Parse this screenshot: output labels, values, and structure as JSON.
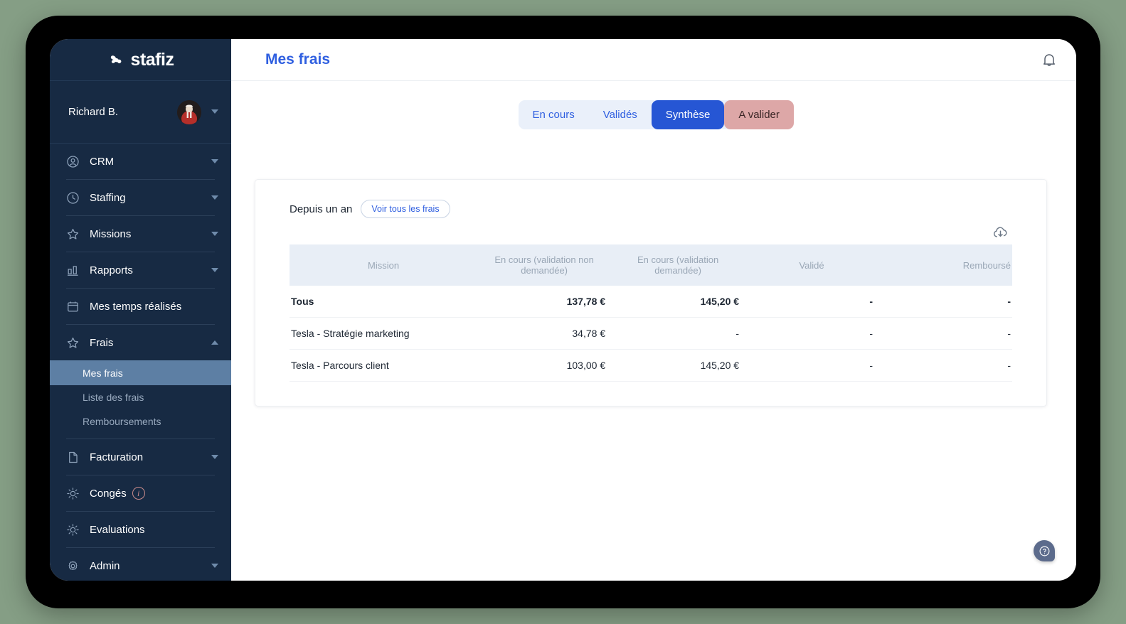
{
  "brand": {
    "name": "stafiz",
    "logo_icon": "stafiz-pinwheel-logo"
  },
  "user": {
    "name": "Richard B.",
    "avatar_icon": "user-avatar"
  },
  "sidebar": {
    "items": [
      {
        "label": "CRM",
        "icon": "user-circle-icon",
        "expandable": true
      },
      {
        "label": "Staffing",
        "icon": "clock-icon",
        "expandable": true
      },
      {
        "label": "Missions",
        "icon": "star-icon",
        "expandable": true
      },
      {
        "label": "Rapports",
        "icon": "bar-chart-icon",
        "expandable": true
      },
      {
        "label": "Mes temps réalisés",
        "icon": "calendar-icon",
        "expandable": false
      },
      {
        "label": "Frais",
        "icon": "star-icon",
        "expandable": true,
        "expanded": true
      },
      {
        "label": "Facturation",
        "icon": "document-icon",
        "expandable": true
      },
      {
        "label": "Congés",
        "icon": "sun-icon",
        "expandable": false,
        "badge": "i"
      },
      {
        "label": "Evaluations",
        "icon": "sun-icon",
        "expandable": false
      },
      {
        "label": "Admin",
        "icon": "gear-icon",
        "expandable": true
      }
    ],
    "frais_subitems": [
      {
        "label": "Mes frais",
        "active": true
      },
      {
        "label": "Liste des frais",
        "active": false
      },
      {
        "label": "Remboursements",
        "active": false
      }
    ]
  },
  "header": {
    "title": "Mes frais",
    "bell_icon": "notification-bell-icon"
  },
  "tabs": [
    {
      "label": "En cours",
      "state": "default"
    },
    {
      "label": "Validés",
      "state": "default"
    },
    {
      "label": "Synthèse",
      "state": "active"
    },
    {
      "label": "A valider",
      "state": "warn"
    }
  ],
  "card": {
    "since_label": "Depuis un an",
    "see_all_label": "Voir tous les frais",
    "download_icon": "cloud-download-icon"
  },
  "table": {
    "columns": [
      "Mission",
      "En cours (validation non demandée)",
      "En cours (validation demandée)",
      "Validé",
      "Remboursé"
    ],
    "rows": [
      {
        "mission": "Tous",
        "pending_not_requested": "137,78 €",
        "pending_requested": "145,20 €",
        "validated": "-",
        "reimbursed": "-",
        "is_total": true
      },
      {
        "mission": "Tesla - Stratégie marketing",
        "pending_not_requested": "34,78 €",
        "pending_requested": "-",
        "validated": "-",
        "reimbursed": "-",
        "is_total": false
      },
      {
        "mission": "Tesla - Parcours client",
        "pending_not_requested": "103,00 €",
        "pending_requested": "145,20 €",
        "validated": "-",
        "reimbursed": "-",
        "is_total": false
      }
    ]
  },
  "help": {
    "icon": "question-mark-icon",
    "label": "?"
  },
  "colors": {
    "sidebar_bg": "#172a43",
    "accent_blue": "#2656d4",
    "title_blue": "#2f5fe0",
    "active_subitem": "#5d7fa4",
    "warn_tab": "#dda7a7",
    "table_head_bg": "#e8eef6",
    "page_bg": "#859e85"
  }
}
